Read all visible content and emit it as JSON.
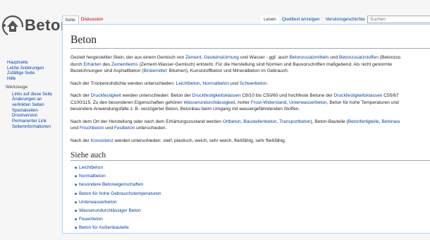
{
  "site": {
    "logo_text": "Beton"
  },
  "sidebar": {
    "nav": [
      "Hauptseite",
      "Letzte Änderungen",
      "Zufällige Seite",
      "Hilfe"
    ],
    "tools_heading": "Werkzeuge",
    "tools": [
      "Links auf diese Seite",
      "Änderungen an",
      "verlinkten Seiten",
      "Spezialseiten",
      "Druckversion",
      "Permanenter Link",
      "Seiteninformationen"
    ]
  },
  "tabs": {
    "page": "Seite",
    "discussion": "Diskussion",
    "read": "Lesen",
    "view_source": "Quelltext anzeigen",
    "history": "Versionsgeschichte"
  },
  "search": {
    "placeholder": "Suchen"
  },
  "article": {
    "title": "Beton",
    "p1": {
      "l1": [
        "Gezielt hergestellter Stein, der aus einem Gemisch von ",
        "Zement",
        ", ",
        "Gesteinskörnung",
        " und Wasser - ggf. auch ",
        "Betonzusatzmitteln",
        " und ",
        "Betonzusatzstoffen",
        " (Betonzus"
      ],
      "l2": [
        "durch ",
        "Erhärten",
        " des ",
        "Zementleims",
        " (Zement-Wasser-Gemisch) entsteht. Für die Herstellung sind Normen und Bauvorschriften maßgebend. Als nicht genormte"
      ],
      "l3": "Bezeichnungen sind Asphaltbeton (",
      "l3_link": "Bindemittel",
      "l3_end": ": Bitumen), Kunststoffbeton und Mineralbeton im Gebrauch."
    },
    "p2": [
      "Nach der Trockenrohdichte werden unterschieden: ",
      "Leichtbeton",
      ", ",
      "Normalbeton",
      " und ",
      "Schwerbeton",
      "."
    ],
    "p3": {
      "l1": [
        "Nach der ",
        "Druckfestigkeit",
        " werden unterschieden: Beton der ",
        "Druckfestigkeitsklassen",
        " C8/10 bis C50/60 und hochfeste Betone der ",
        "Druckfestigkeitsklassen",
        " C55/67"
      ],
      "l2": [
        "C100/115. Zu den besonderen Eigenschaften gehören ",
        "Wasserundurchlässigkeit",
        ", hoher ",
        "Frost-Widerstand",
        ", ",
        "Unterwasserbeton",
        ", Beton für hohe Temperaturen und"
      ],
      "l3": "besondere Anwendungsfälle z. B. verzögerter Beton, Betonbau beim Umgang mit wassergefährdenden Stoffen."
    },
    "p4": {
      "l1": [
        "Nach dem Ort der Herstellung oder nach dem Erhärtungszustand werden ",
        "Ortbeton",
        ", ",
        "Baustellenbeton",
        ", ",
        "Transportbeton",
        "), Beton-Bauteile (",
        "Betonfertigteile",
        ", ",
        "Betonwa"
      ],
      "l2": [
        "und ",
        "Frischbeton",
        " und ",
        "Festbeton",
        " unterschieden."
      ]
    },
    "p5": [
      "Nach der ",
      "Konsistenz",
      " werden unterschieden: steif, plastisch, weich, sehr weich, fließfähig, sehr fließfähig."
    ],
    "see_also_title": "Siehe auch",
    "see_also": [
      "Leichtbeton",
      "Normalbeton",
      "besondere Betoneigenschaften",
      "Beton für hohe Gebrauchstemperaturen",
      "Unterwasserbeton",
      "Wasserundurchlässiger Beton",
      "Feuerbeton",
      "Beton für Außenbauteile"
    ]
  }
}
